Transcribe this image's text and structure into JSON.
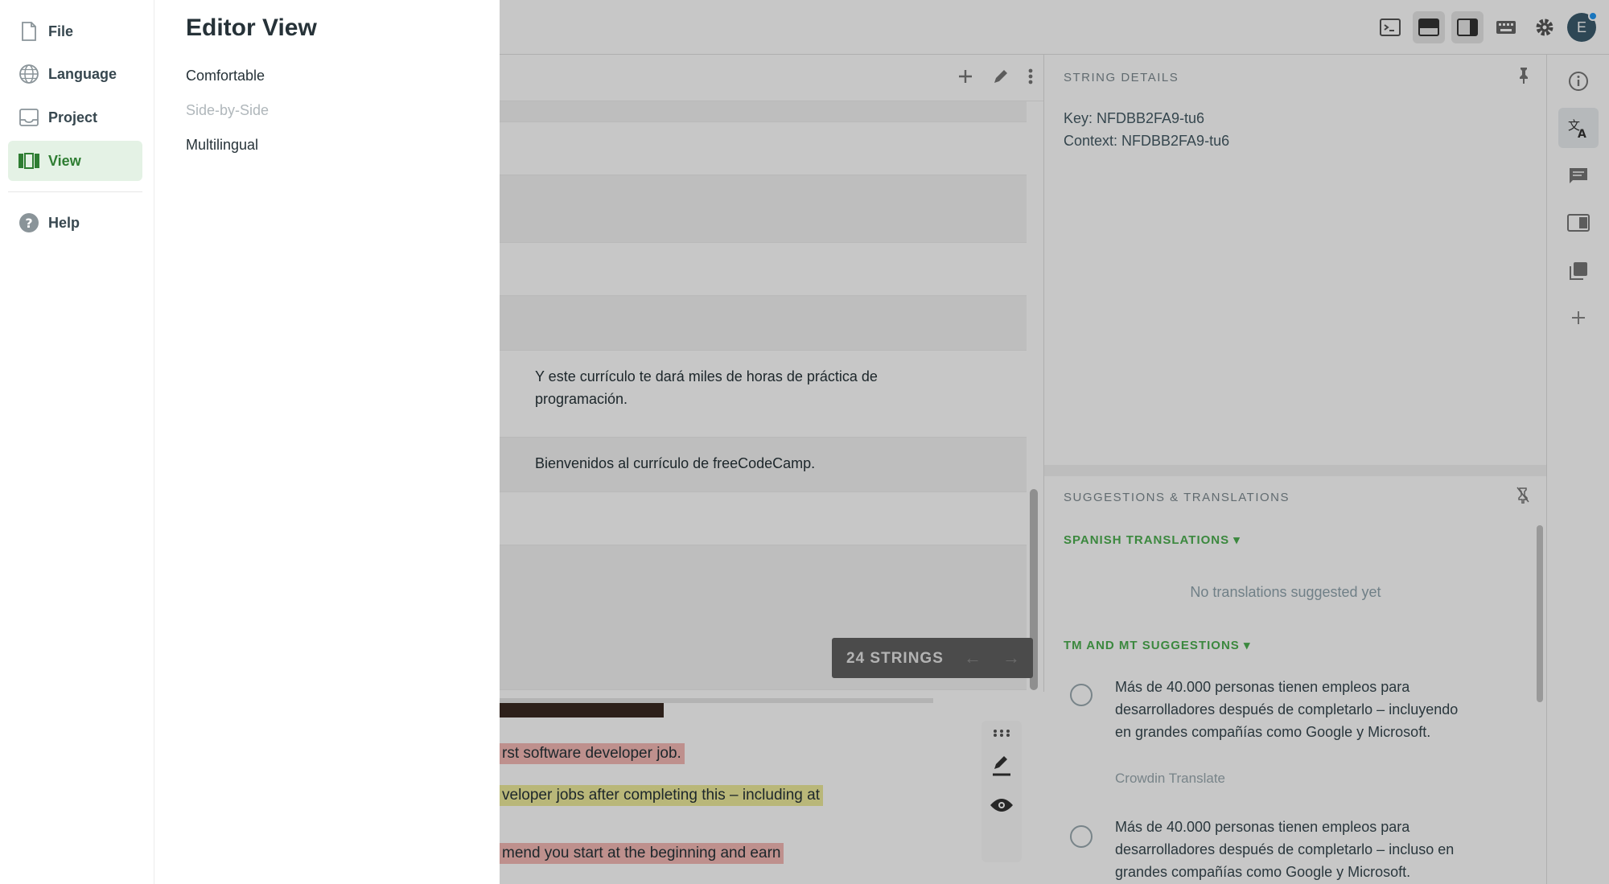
{
  "menu": {
    "items": [
      {
        "label": "File",
        "icon": "file-icon"
      },
      {
        "label": "Language",
        "icon": "globe-icon"
      },
      {
        "label": "Project",
        "icon": "project-icon"
      },
      {
        "label": "View",
        "icon": "view-icon",
        "active": true
      },
      {
        "label": "Help",
        "icon": "help-icon"
      }
    ]
  },
  "submenu": {
    "title": "Editor View",
    "options": [
      {
        "label": "Comfortable",
        "enabled": true
      },
      {
        "label": "Side-by-Side",
        "enabled": false
      },
      {
        "label": "Multilingual",
        "enabled": true
      }
    ]
  },
  "topbar": {
    "avatar_initial": "E"
  },
  "strings": {
    "rows": [
      {
        "text": "Y este currículo te dará miles de horas de práctica de programación."
      },
      {
        "text": "Bienvenidos al currículo de freeCodeCamp."
      }
    ],
    "counter": "24 STRINGS"
  },
  "preview": {
    "lines": [
      {
        "text": "rst software developer job.",
        "highlight": "red"
      },
      {
        "text": "veloper jobs after completing this – including at",
        "highlight": "yellow"
      },
      {
        "text": "mend you start at the beginning and earn",
        "highlight": "red"
      }
    ]
  },
  "details": {
    "title": "STRING DETAILS",
    "key": "Key: NFDBB2FA9-tu6",
    "context": "Context: NFDBB2FA9-tu6"
  },
  "suggestions": {
    "title": "SUGGESTIONS & TRANSLATIONS",
    "spanish_title": "SPANISH TRANSLATIONS",
    "empty": "No translations suggested yet",
    "tm_title": "TM AND MT SUGGESTIONS",
    "items": [
      {
        "text": "Más de 40.000 personas tienen empleos para desarrolladores después de completarlo – incluyendo en grandes compañías como Google y Microsoft.",
        "source": "Crowdin Translate"
      },
      {
        "text": "Más de 40.000 personas tienen empleos para desarrolladores después de completarlo – incluso en grandes compañías como Google y Microsoft."
      }
    ]
  },
  "colors": {
    "accent": "#2e7d32",
    "active_bg": "#e4f2e5",
    "overlay": "rgba(0,0,0,0.22)"
  }
}
